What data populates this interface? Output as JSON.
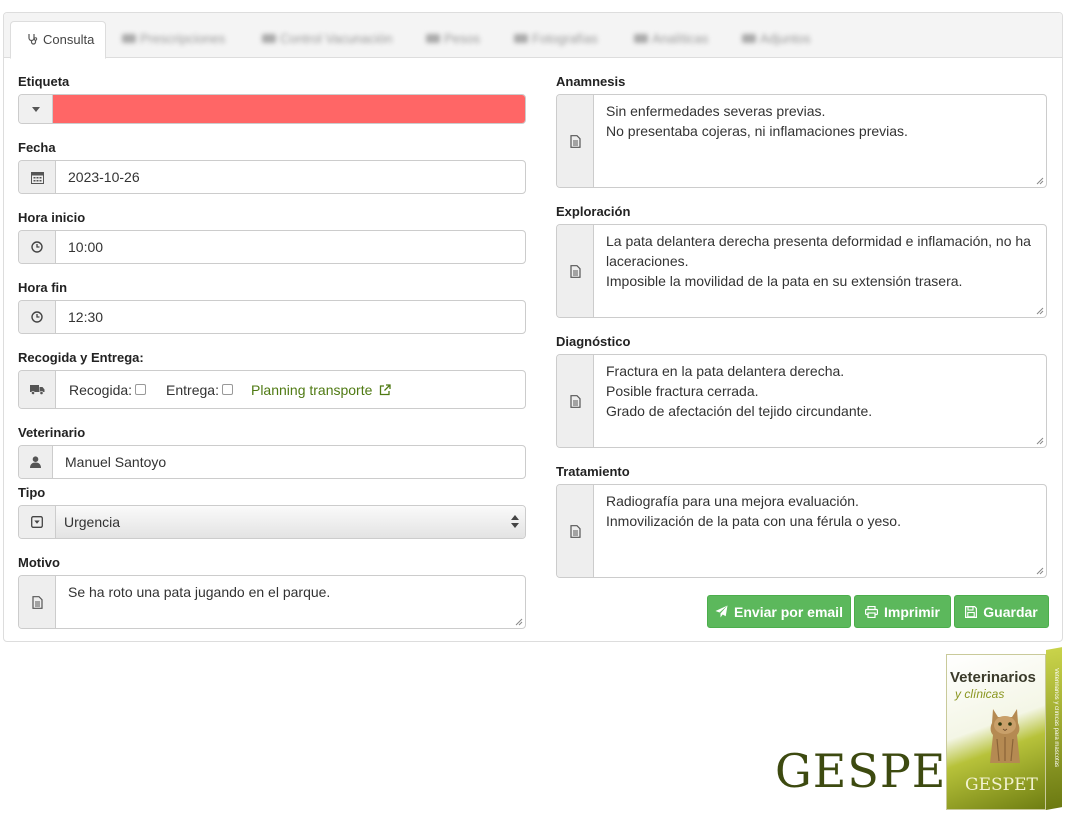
{
  "tabs": [
    {
      "label": "Consulta",
      "icon": "stethoscope-icon",
      "active": true
    },
    {
      "label": "Prescripciones",
      "icon": "list-icon",
      "blurred": true
    },
    {
      "label": "Control Vacunación",
      "icon": "shield-icon",
      "blurred": true
    },
    {
      "label": "Pesos",
      "icon": "chart-icon",
      "blurred": true
    },
    {
      "label": "Fotografías",
      "icon": "file-icon",
      "blurred": true
    },
    {
      "label": "Analíticas",
      "icon": "flask-icon",
      "blurred": true
    },
    {
      "label": "Adjuntos",
      "icon": "paperclip-icon",
      "blurred": true
    }
  ],
  "left": {
    "etiqueta": {
      "label": "Etiqueta",
      "color": "#ff6666"
    },
    "fecha": {
      "label": "Fecha",
      "value": "2023-10-26"
    },
    "hora_inicio": {
      "label": "Hora inicio",
      "value": "10:00"
    },
    "hora_fin": {
      "label": "Hora fin",
      "value": "12:30"
    },
    "recogida": {
      "label": "Recogida y Entrega:",
      "recogida_label": "Recogida:",
      "entrega_label": "Entrega:",
      "link": "Planning transporte"
    },
    "veterinario": {
      "label": "Veterinario",
      "value": "Manuel Santoyo"
    },
    "tipo": {
      "label": "Tipo",
      "value": "Urgencia"
    },
    "motivo": {
      "label": "Motivo",
      "value": "Se ha roto una pata jugando en el parque."
    }
  },
  "right": {
    "anamnesis": {
      "label": "Anamnesis",
      "lines": [
        "Sin enfermedades severas previas.",
        "No presentaba cojeras, ni inflamaciones previas."
      ]
    },
    "exploracion": {
      "label": "Exploración",
      "lines": [
        "La pata delantera derecha presenta deformidad e inflamación, no ha",
        "laceraciones.",
        "Imposible la movilidad de la pata en su extensión trasera."
      ]
    },
    "diagnostico": {
      "label": "Diagnóstico",
      "lines": [
        "Fractura en la pata delantera derecha.",
        "Posible fractura cerrada.",
        "Grado de afectación del tejido circundante."
      ]
    },
    "tratamiento": {
      "label": "Tratamiento",
      "lines": [
        "Radiografía para una mejora evaluación.",
        "Inmovilización de la pata con una férula o yeso."
      ]
    }
  },
  "buttons": {
    "email": "Enviar por email",
    "print": "Imprimir",
    "save": "Guardar"
  },
  "branding": {
    "logo": "GESPET",
    "box_title": "Veterinarios",
    "box_subtitle": "y clínicas",
    "box_brand": "GESPET",
    "box_side": "Veterinarios y clínicas para mascotas",
    "accent": "#5cb85c",
    "link_color": "#4f7a13"
  }
}
